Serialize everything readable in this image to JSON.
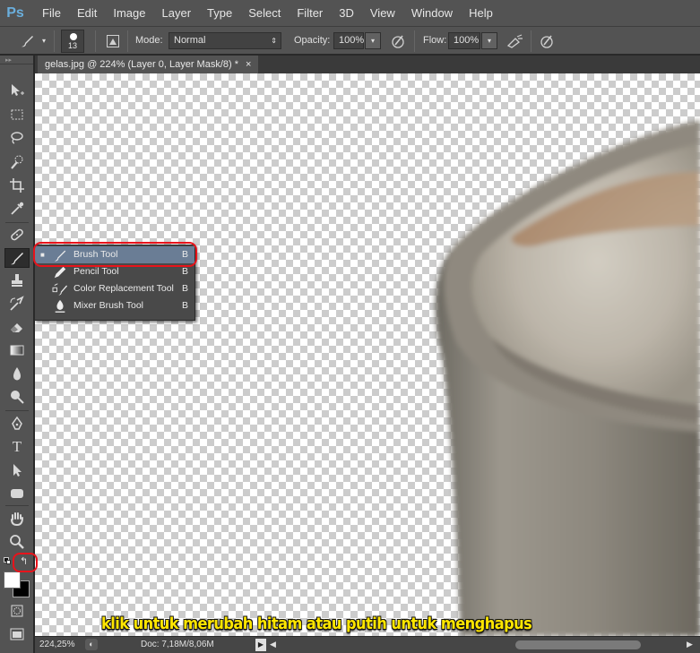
{
  "app": {
    "logo": "Ps"
  },
  "menu": [
    "File",
    "Edit",
    "Image",
    "Layer",
    "Type",
    "Select",
    "Filter",
    "3D",
    "View",
    "Window",
    "Help"
  ],
  "options": {
    "brush_size": "13",
    "mode_label": "Mode:",
    "mode_value": "Normal",
    "opacity_label": "Opacity:",
    "opacity_value": "100%",
    "flow_label": "Flow:",
    "flow_value": "100%"
  },
  "document": {
    "tab_title": "gelas.jpg @ 224% (Layer 0, Layer Mask/8) *",
    "close_glyph": "×"
  },
  "status": {
    "zoom": "224,25%",
    "doc_info": "Doc: 7,18M/8,06M"
  },
  "flyout": {
    "items": [
      {
        "label": "Brush Tool",
        "key": "B",
        "icon": "brush-icon",
        "selected": true
      },
      {
        "label": "Pencil Tool",
        "key": "B",
        "icon": "pencil-icon",
        "selected": false
      },
      {
        "label": "Color Replacement Tool",
        "key": "B",
        "icon": "color-replacement-icon",
        "selected": false
      },
      {
        "label": "Mixer Brush Tool",
        "key": "B",
        "icon": "mixer-brush-icon",
        "selected": false
      }
    ]
  },
  "annotation": {
    "caption": "klik untuk merubah hitam atau putih untuk menghapus",
    "highlight_color": "#e8131b",
    "caption_color": "#ffe600"
  },
  "tools": [
    "move-icon",
    "marquee-icon",
    "lasso-icon",
    "quick-selection-icon",
    "crop-icon",
    "eyedropper-icon",
    "healing-brush-icon",
    "brush-icon",
    "clone-stamp-icon",
    "history-brush-icon",
    "eraser-icon",
    "gradient-icon",
    "blur-icon",
    "dodge-icon",
    "pen-icon",
    "type-icon",
    "path-selection-icon",
    "shape-icon",
    "hand-icon",
    "zoom-icon",
    "swap-colors-icon",
    "quick-mask-icon",
    "screen-mode-icon"
  ]
}
